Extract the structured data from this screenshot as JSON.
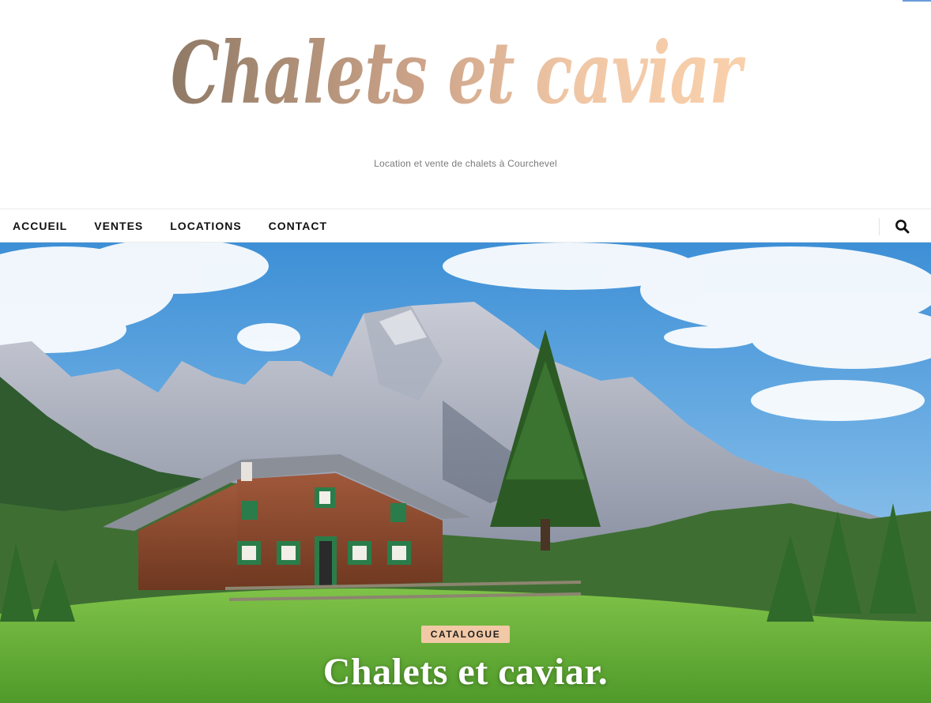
{
  "site": {
    "logo_text": "Chalets et caviar",
    "tagline": "Location et vente de chalets à Courchevel"
  },
  "nav": {
    "items": [
      {
        "label": "ACCUEIL"
      },
      {
        "label": "VENTES"
      },
      {
        "label": "LOCATIONS"
      },
      {
        "label": "CONTACT"
      }
    ],
    "search_icon": "search-icon"
  },
  "hero": {
    "category": "CATALOGUE",
    "title": "Chalets et caviar."
  },
  "colors": {
    "logo_start": "#8f7a66",
    "logo_end": "#f6c9a1",
    "badge_bg": "#f2c9a6",
    "accent_blue": "#6a9bd8"
  }
}
